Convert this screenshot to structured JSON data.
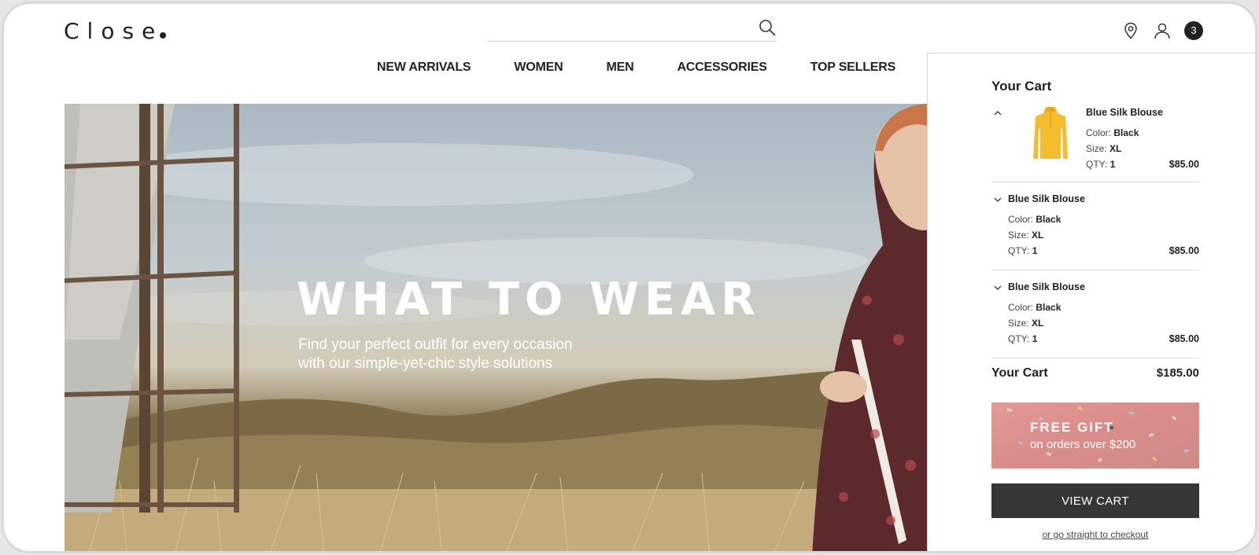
{
  "brand": {
    "logo_text": "Close"
  },
  "search": {
    "placeholder": "",
    "value": ""
  },
  "header_icons": [
    "location-pin-icon",
    "user-icon",
    "cart-count-badge"
  ],
  "cart_count": "3",
  "nav": {
    "items": [
      {
        "label": "NEW ARRIVALS"
      },
      {
        "label": "WOMEN"
      },
      {
        "label": "MEN"
      },
      {
        "label": "ACCESSORIES"
      },
      {
        "label": "TOP SELLERS"
      }
    ]
  },
  "hero": {
    "title": "WHAT TO WEAR",
    "subtitle_line1": "Find your perfect outfit for every occasion",
    "subtitle_line2": "with our simple-yet-chic style solutions"
  },
  "cart": {
    "title": "Your Cart",
    "items": [
      {
        "name": "Blue Silk Blouse",
        "color_label": "Color:",
        "color": "Black",
        "size_label": "Size:",
        "size": "XL",
        "qty_label": "QTY:",
        "qty": "1",
        "price": "$85.00",
        "expanded": true,
        "thumb_color": "#f5bd2e"
      },
      {
        "name": "Blue Silk Blouse",
        "color_label": "Color:",
        "color": "Black",
        "size_label": "Size:",
        "size": "XL",
        "qty_label": "QTY:",
        "qty": "1",
        "price": "$85.00",
        "expanded": false
      },
      {
        "name": "Blue Silk Blouse",
        "color_label": "Color:",
        "color": "Black",
        "size_label": "Size:",
        "size": "XL",
        "qty_label": "QTY:",
        "qty": "1",
        "price": "$85.00",
        "expanded": false
      }
    ],
    "total_label": "Your Cart",
    "total_value": "$185.00",
    "promo": {
      "title": "FREE GIFT",
      "subtitle": "on orders over $200"
    },
    "view_cart_label": "VIEW CART",
    "checkout_link": "or go straight to checkout"
  },
  "colors": {
    "accent_dark": "#363636",
    "promo_bg": "#d98c8a",
    "text": "#222222"
  }
}
